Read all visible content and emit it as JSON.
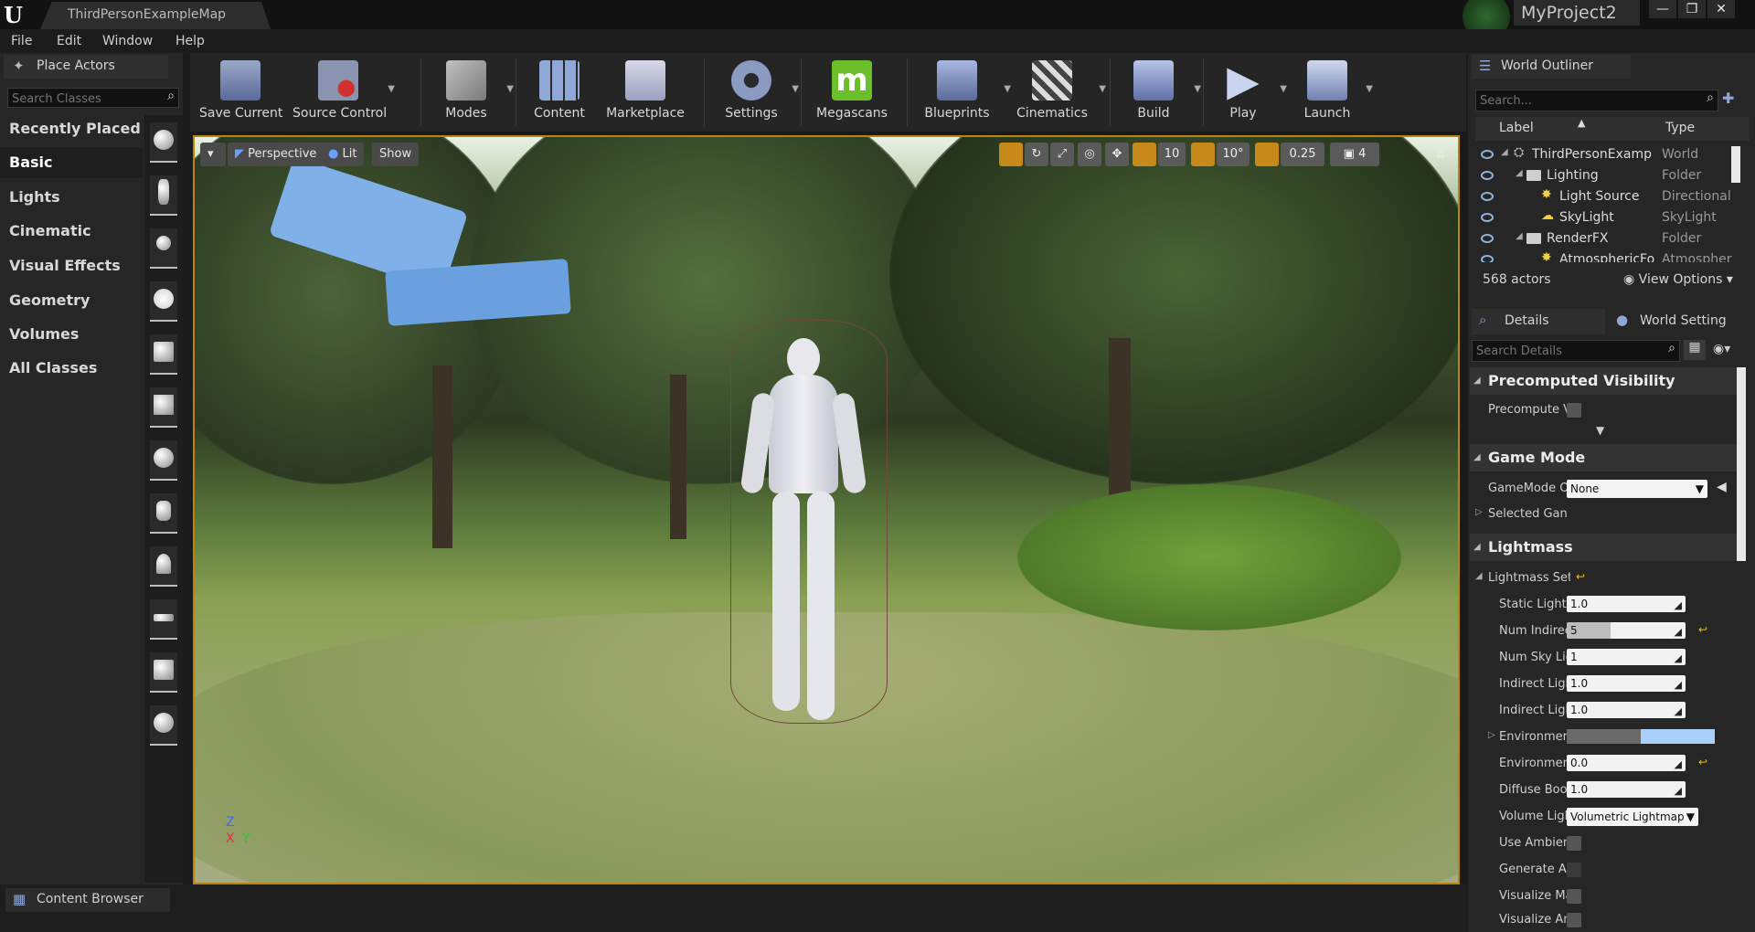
{
  "titlebar": {
    "map_tab": "ThirdPersonExampleMap",
    "project_name": "MyProject2",
    "minimize": "—",
    "maximize": "❐",
    "close": "✕"
  },
  "menu": [
    "File",
    "Edit",
    "Window",
    "Help"
  ],
  "place_actors": {
    "tab_label": "Place Actors",
    "search_placeholder": "Search Classes",
    "categories": [
      "Recently Placed",
      "Basic",
      "Lights",
      "Cinematic",
      "Visual Effects",
      "Geometry",
      "Volumes",
      "All Classes"
    ],
    "active_category": "Basic"
  },
  "toolbar": {
    "save_current": "Save Current",
    "source_control": "Source Control",
    "modes": "Modes",
    "content": "Content",
    "marketplace": "Marketplace",
    "settings": "Settings",
    "megascans": "Megascans",
    "blueprints": "Blueprints",
    "cinematics": "Cinematics",
    "build": "Build",
    "play": "Play",
    "launch": "Launch"
  },
  "viewport": {
    "perspective": "Perspective",
    "lit": "Lit",
    "show": "Show",
    "grid_snap": "10",
    "rotation_snap": "10°",
    "scale_snap": "0.25",
    "camera_speed": "4",
    "axis_z": "Z",
    "axis_x": "X",
    "axis_y": "Y"
  },
  "content_browser": {
    "tab_label": "Content Browser"
  },
  "world_outliner": {
    "tab_label": "World Outliner",
    "search_placeholder": "Search...",
    "col_label": "Label",
    "col_type": "Type",
    "rows": [
      {
        "name": "ThirdPersonExamp",
        "type": "World"
      },
      {
        "name": "Lighting",
        "type": "Folder"
      },
      {
        "name": "Light Source",
        "type": "Directional"
      },
      {
        "name": "SkyLight",
        "type": "SkyLight"
      },
      {
        "name": "RenderFX",
        "type": "Folder"
      },
      {
        "name": "AtmosphericFo",
        "type": "Atmospher"
      }
    ],
    "actor_count": "568 actors",
    "view_options": "View Options"
  },
  "details": {
    "tab_details": "Details",
    "tab_world_settings": "World Setting",
    "search_placeholder": "Search Details",
    "sections": {
      "precomputed_visibility": "Precomputed Visibility",
      "game_mode": "Game Mode",
      "lightmass": "Lightmass"
    },
    "precompute_label": "Precompute V",
    "gamemode_label": "GameMode O",
    "gamemode_value": "None",
    "selected_game_label": "Selected Gan",
    "lightmass_settings_label": "Lightmass Set",
    "static_lighting_label": "Static Lightin",
    "static_lighting_value": "1.0",
    "num_indirect_label": "Num Indirec",
    "num_indirect_value": "5",
    "num_sky_label": "Num Sky Lig",
    "num_sky_value": "1",
    "indirect1_label": "Indirect Ligh",
    "indirect1_value": "1.0",
    "indirect2_label": "Indirect Ligh",
    "indirect2_value": "1.0",
    "environment_color_label": "Environmer",
    "environment_intensity_label": "Environmen",
    "environment_intensity_value": "0.0",
    "diffuse_boost_label": "Diffuse Boos",
    "diffuse_boost_value": "1.0",
    "volume_lighting_label": "Volume Ligh",
    "volume_lighting_value": "Volumetric Lightmap",
    "use_ambient_label": "Use Ambien",
    "generate_label": "Generate Ar",
    "visualize1_label": "Visualize Ma",
    "visualize2_label": "Visualize An"
  },
  "colors": {
    "accent_orange": "#c78a1a",
    "selection_blue": "#8fb3d8",
    "megascans_green": "#6bbf2a"
  }
}
